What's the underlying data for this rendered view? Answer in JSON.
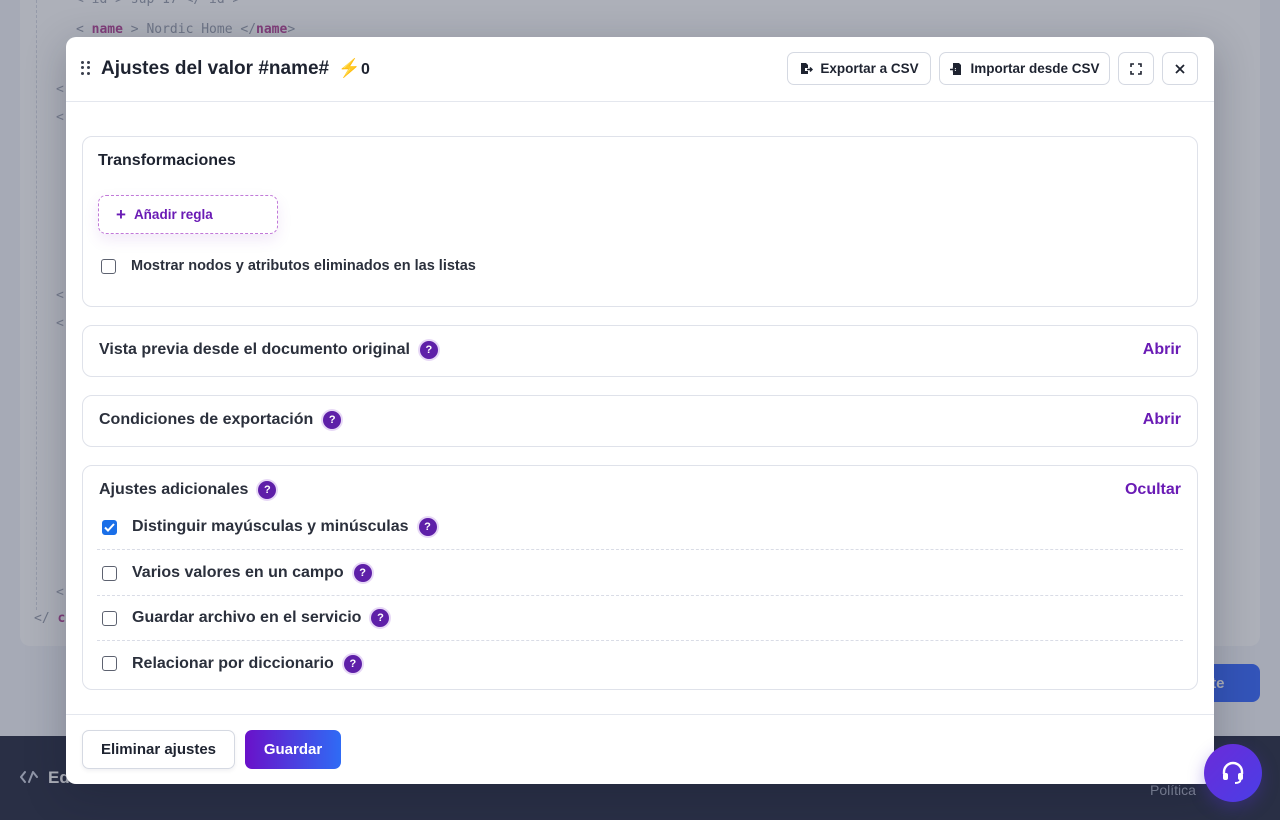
{
  "background": {
    "code_open_line": {
      "lt": "<",
      "tag": "name",
      "gt": ">",
      "value": "Nordic Home",
      "close_open": "</",
      "close_tag": "name",
      "close_gt": ">"
    },
    "code_top_line": "< id > sup-17 </ id >",
    "closing_tag_prefix": "</",
    "closing_tag_name": "c",
    "primary_button_fragment": "nte",
    "footer_logo_fragment": "Ed",
    "footer_policy_fragment": "Política"
  },
  "modal": {
    "title": "Ajustes del valor #name#",
    "bolt_count": "0",
    "header_buttons": {
      "export_label": "Exportar a CSV",
      "import_label": "Importar desde CSV"
    },
    "transformations": {
      "title": "Transformaciones",
      "add_rule_label": "Añadir regla",
      "show_deleted_label": "Mostrar nodos y atributos eliminados en las listas",
      "show_deleted_checked": false
    },
    "preview": {
      "title": "Vista previa desde el documento original",
      "action_label": "Abrir"
    },
    "conditions": {
      "title": "Condiciones de exportación",
      "action_label": "Abrir"
    },
    "additional": {
      "title": "Ajustes adicionales",
      "action_label": "Ocultar",
      "options": [
        {
          "label": "Distinguir mayúsculas y minúsculas",
          "checked": true
        },
        {
          "label": "Varios valores en un campo",
          "checked": false
        },
        {
          "label": "Guardar archivo en el servicio",
          "checked": false
        },
        {
          "label": "Relacionar por diccionario",
          "checked": false
        }
      ]
    },
    "footer": {
      "remove_label": "Eliminar ajustes",
      "save_label": "Guardar"
    }
  },
  "colors": {
    "accent_purple": "#6a1bb5",
    "checkbox_blue": "#1a6fe8",
    "save_gradient_start": "#6a11c9",
    "save_gradient_end": "#2f6bf5"
  },
  "icons": {
    "drag": "drag-handle-icon",
    "bolt": "lightning-bolt-icon",
    "export": "file-export-icon",
    "import": "file-import-icon",
    "expand": "expand-icon",
    "close": "close-icon",
    "help": "question-mark-icon",
    "support": "headset-icon"
  }
}
